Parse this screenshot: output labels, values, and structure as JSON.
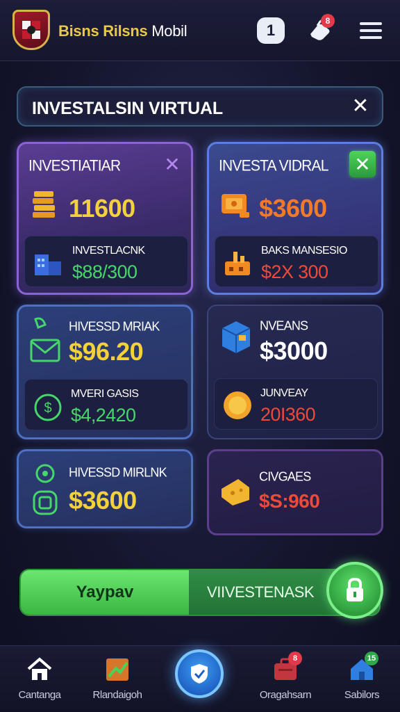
{
  "header": {
    "brand_highlight": "Bisns Rilsns",
    "brand_tail": "Mobil",
    "chat_badge": "1",
    "hand_badge": "8"
  },
  "title_bar": {
    "title": "INVESTALSIN VIRTUAL"
  },
  "cards": [
    {
      "title": "INVESTIATIAR",
      "value": "11600",
      "sub_label": "INVESTLACNK",
      "sub_value": "$88/300"
    },
    {
      "title": "INVESTA VIDRAL",
      "value": "$3600",
      "sub_label": "BAKS MANSESIO",
      "sub_value": "$2X 300"
    },
    {
      "title": "HIVESSD MRIAK",
      "value": "$96.20",
      "sub_label": "MVERI GASIS",
      "sub_value": "$4,2420"
    },
    {
      "title": "NVEANS",
      "value": "$3000",
      "sub_label": "JUNVEAY",
      "sub_value": "20I360"
    },
    {
      "title": "HIVESSD MIRLNK",
      "value": "$3600"
    },
    {
      "title": "CIVGAES",
      "value": "$S:960"
    }
  ],
  "action": {
    "left_label": "Yaypav",
    "right_label": "VIIVESTENASK"
  },
  "nav": [
    {
      "label": "Cantanga"
    },
    {
      "label": "Rlandaigoh"
    },
    {
      "label": "Oragahsarn",
      "badge": "8"
    },
    {
      "label": "Sabilors",
      "badge": "15"
    }
  ],
  "colors": {
    "accent_yellow": "#f3d13c",
    "accent_orange": "#f07a2a",
    "accent_green": "#46d66a",
    "accent_red": "#ee4a3a"
  }
}
